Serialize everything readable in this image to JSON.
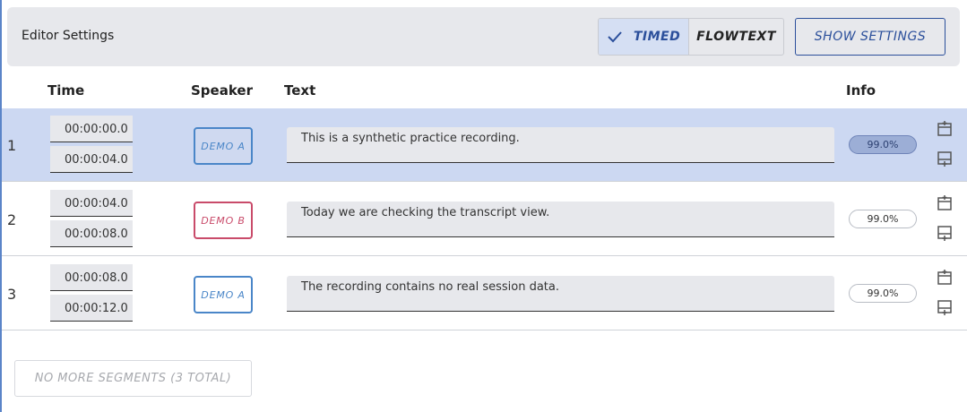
{
  "settings_bar": {
    "title": "Editor Settings",
    "mode_timed_label": "TIMED",
    "mode_flowtext_label": "FLOWTEXT",
    "show_settings_label": "SHOW SETTINGS"
  },
  "columns": {
    "time": "Time",
    "speaker": "Speaker",
    "text": "Text",
    "info": "Info"
  },
  "segments": [
    {
      "num": "1",
      "start": "00:00:00.0",
      "end": "00:00:04.0",
      "speaker": "DEMO A",
      "text": "This is a synthetic practice recording.",
      "confidence": "99.0%"
    },
    {
      "num": "2",
      "start": "00:00:04.0",
      "end": "00:00:08.0",
      "speaker": "DEMO B",
      "text": "Today we are checking the transcript view.",
      "confidence": "99.0%"
    },
    {
      "num": "3",
      "start": "00:00:08.0",
      "end": "00:00:12.0",
      "speaker": "DEMO A",
      "text": "The recording contains no real session data.",
      "confidence": "99.0%"
    }
  ],
  "footer": {
    "no_more_label": "NO MORE SEGMENTS (3 TOTAL)"
  },
  "colors": {
    "accent": "#2b4f9b",
    "selected_row": "#ccd8f2",
    "speaker_a": "#4a86c8",
    "speaker_b": "#c94b6a"
  },
  "icons": {
    "insert_above": "insert-segment-above-icon",
    "insert_below": "insert-segment-below-icon",
    "mode_check": "check-icon"
  }
}
